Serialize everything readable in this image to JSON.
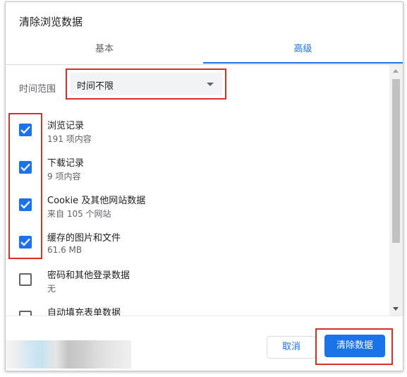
{
  "dialog": {
    "title": "清除浏览数据",
    "tabs": [
      {
        "label": "基本",
        "active": false
      },
      {
        "label": "高级",
        "active": true
      }
    ],
    "time_range": {
      "label": "时间范围",
      "selected": "时间不限"
    },
    "items": [
      {
        "title": "浏览记录",
        "subtitle": "191 项内容",
        "checked": true
      },
      {
        "title": "下载记录",
        "subtitle": "9 项内容",
        "checked": true
      },
      {
        "title": "Cookie 及其他网站数据",
        "subtitle": "来自 105 个网站",
        "checked": true
      },
      {
        "title": "缓存的图片和文件",
        "subtitle": "61.6 MB",
        "checked": true
      },
      {
        "title": "密码和其他登录数据",
        "subtitle": "无",
        "checked": false
      },
      {
        "title": "自动填充表单数据",
        "subtitle": "",
        "checked": false
      }
    ],
    "buttons": {
      "cancel": "取消",
      "clear": "清除数据"
    }
  },
  "colors": {
    "accent": "#1a73e8",
    "highlight": "#d93025"
  }
}
